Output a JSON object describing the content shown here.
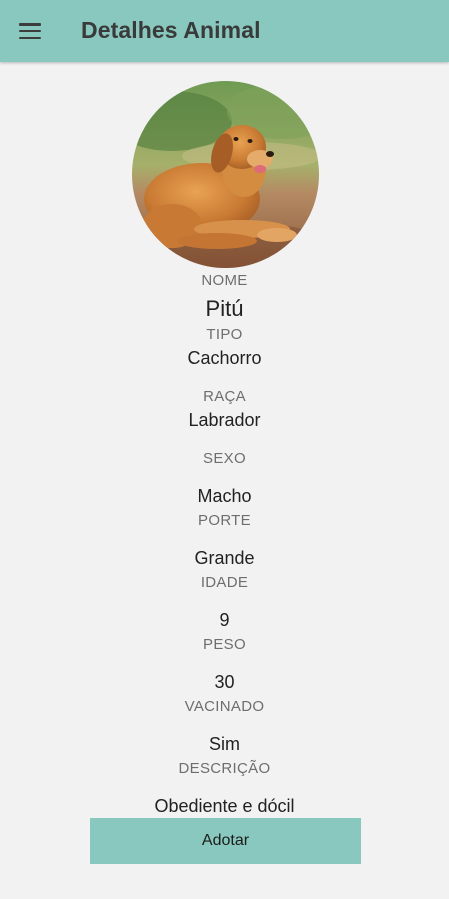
{
  "colors": {
    "accent": "#88c8be",
    "background": "#f2f2f2",
    "label": "#6e6e6e",
    "value": "#222222"
  },
  "header": {
    "menu_icon": "hamburger-menu-icon",
    "title": "Detalhes Animal"
  },
  "animal": {
    "photo_subject": "golden-retriever-dog",
    "fields": {
      "nome": {
        "label": "NOME",
        "value": "Pitú"
      },
      "tipo": {
        "label": "TIPO",
        "value": "Cachorro"
      },
      "raca": {
        "label": "RAÇA",
        "value": "Labrador"
      },
      "sexo": {
        "label": "SEXO",
        "value": "Macho"
      },
      "porte": {
        "label": "PORTE",
        "value": "Grande"
      },
      "idade": {
        "label": "IDADE",
        "value": "9"
      },
      "peso": {
        "label": "PESO",
        "value": "30"
      },
      "vacinado": {
        "label": "VACINADO",
        "value": "Sim"
      },
      "descricao": {
        "label": "DESCRIÇÃO",
        "value": "Obediente e dócil"
      }
    }
  },
  "actions": {
    "adopt_label": "Adotar"
  }
}
